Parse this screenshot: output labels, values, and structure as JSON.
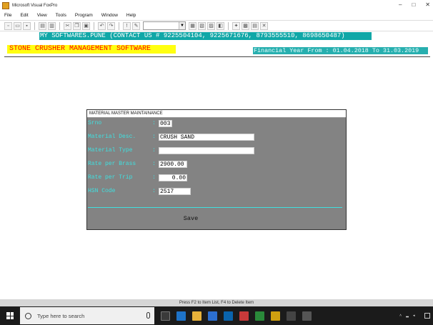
{
  "window": {
    "title": "Microsoft Visual FoxPro"
  },
  "menu": [
    "File",
    "Edit",
    "View",
    "Tools",
    "Program",
    "Window",
    "Help"
  ],
  "banners": {
    "company": "MY SOFTWARES.PUNE (CONTACT US # 9225504104, 9225671676, 8793555510, 8698650487)",
    "app_title": "STONE CRUSHER MANAGEMENT SOFTWARE",
    "financial_year": "Financial Year From : 01.04.2018 To 31.03.2019"
  },
  "dialog": {
    "title": "MATERIAL MASTER MAINTAINANCE",
    "fields": [
      {
        "label": "Srno",
        "value": "003"
      },
      {
        "label": "Material Desc.",
        "value": "CRUSH SAND"
      },
      {
        "label": "Material Type",
        "value": ""
      },
      {
        "label": "Rate per Brass",
        "value": "2900.00"
      },
      {
        "label": "Rate per Trip",
        "value": "0.00"
      },
      {
        "label": "HSN Code",
        "value": "2517"
      }
    ],
    "colon": ":",
    "save_label": "Save"
  },
  "status": {
    "hint": "Press F2 to Item List, F4 to Delete Item"
  },
  "taskbar": {
    "search_placeholder": "Type here to search"
  },
  "colors": {
    "banner_teal": "#10a7a7",
    "title_yellow": "#ffff10",
    "title_red": "#ff0000",
    "label_cyan": "#3fe0e0",
    "dialog_gray": "#838383"
  }
}
